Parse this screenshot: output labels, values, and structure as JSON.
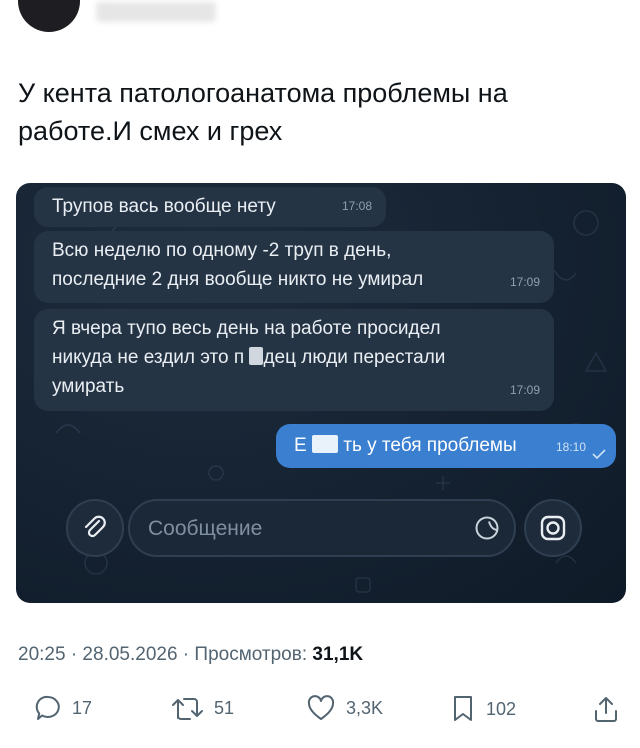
{
  "tweet": {
    "text": "У кента патологоанатома проблемы на работе.И смех и грех"
  },
  "chat": {
    "messages": [
      {
        "direction": "in",
        "text": "Трупов вась вообще нету",
        "time": "17:08"
      },
      {
        "direction": "in",
        "line1": "Всю неделю по одному -2 труп в день,",
        "line2": "последние 2 дня вообще никто не умирал",
        "time": "17:09"
      },
      {
        "direction": "in",
        "line1": "Я вчера тупо весь день на работе просидел",
        "line2a": "никуда не ездил это п",
        "line2b": "дец люди перестали",
        "line3": "умирать",
        "time": "17:09"
      },
      {
        "direction": "out",
        "text_a": "Е",
        "text_b": "ть у тебя проблемы",
        "time": "18:10",
        "status": "read-check"
      }
    ],
    "input": {
      "placeholder": "Сообщение"
    },
    "icons": {
      "attach": "paperclip-icon",
      "sticker": "sticker-icon",
      "camera": "camera-icon"
    }
  },
  "meta": {
    "time_date": "20:25 · 28.05.2026 · Просмотров: ",
    "views": "31,1K"
  },
  "actions": {
    "replies": "17",
    "reposts": "51",
    "likes": "3,3K",
    "bookmarks": "102"
  },
  "colors": {
    "chat_bg": "#142130",
    "bubble_in": "#253445",
    "bubble_out": "#3a7fd0",
    "secondary_text": "#536471"
  }
}
